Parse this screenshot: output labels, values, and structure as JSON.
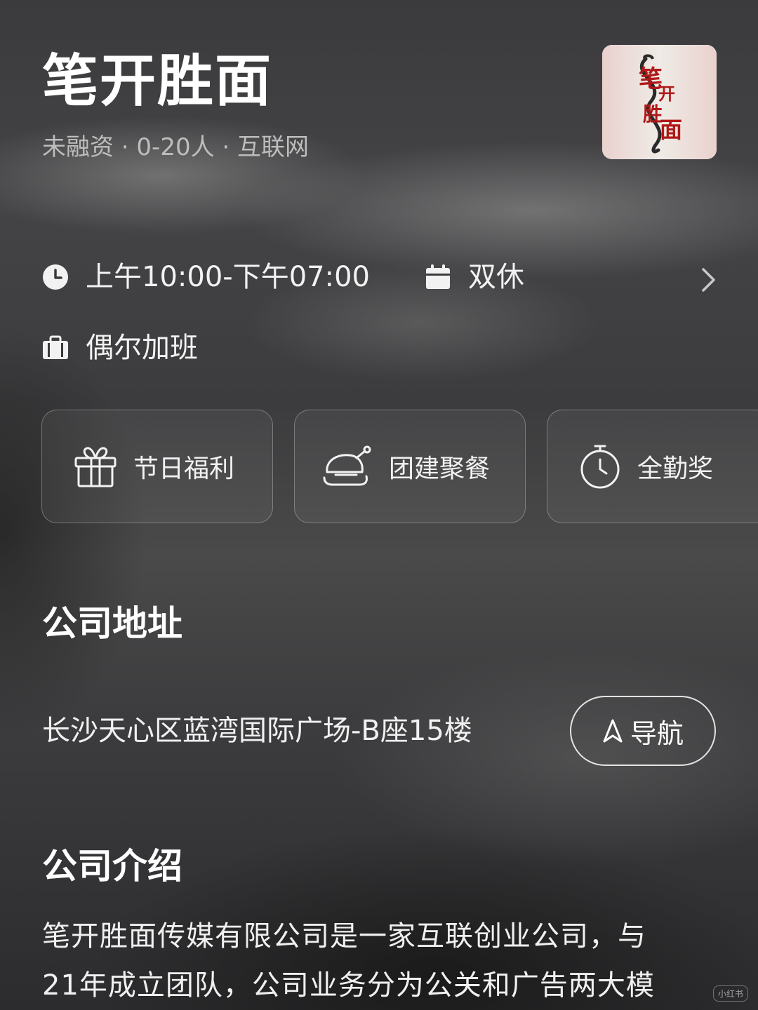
{
  "company": {
    "name": "笔开胜面",
    "meta": "未融资 · 0-20人 · 互联网",
    "logo_text": "笔开胜面"
  },
  "work_info": {
    "hours": "上午10:00-下午07:00",
    "rest": "双休",
    "overtime": "偶尔加班"
  },
  "benefits": [
    {
      "label": "节日福利",
      "icon": "gift-icon"
    },
    {
      "label": "团建聚餐",
      "icon": "roast-chicken-icon"
    },
    {
      "label": "全勤奖",
      "icon": "stopwatch-icon"
    }
  ],
  "address_section": {
    "title": "公司地址",
    "address": "长沙天心区蓝湾国际广场-B座15楼",
    "nav_label": "导航"
  },
  "intro_section": {
    "title": "公司介绍",
    "line1": "笔开胜面传媒有限公司是一家互联创业公司，与",
    "line2": "21年成立团队，公司业务分为公关和广告两大模"
  },
  "watermark": "小红书"
}
